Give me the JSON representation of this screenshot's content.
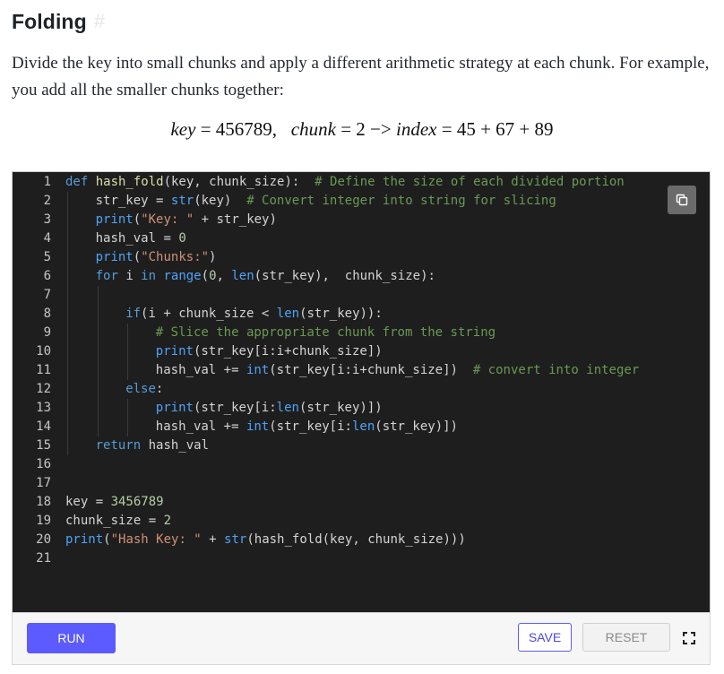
{
  "section": {
    "title": "Folding",
    "anchor": "#"
  },
  "intro": "Divide the key into small chunks and apply a different arithmetic strategy at each chunk. For example, you add all the smaller chunks together:",
  "formula": {
    "key_name": "key",
    "eq1": " = ",
    "key_value": "456789",
    "sep": ",   ",
    "chunk_name": "chunk",
    "eq2": " = ",
    "chunk_value": "2",
    "arrow": " −> ",
    "index_name": "index",
    "eq3": " = ",
    "index_expr": "45 + 67 + 89"
  },
  "editor": {
    "copy_icon": "copy-icon",
    "lines": [
      {
        "n": "1",
        "indent": 0,
        "tokens": [
          [
            "kw",
            "def "
          ],
          [
            "fn",
            "hash_fold"
          ],
          [
            "pl",
            "(key, chunk_size):  "
          ],
          [
            "com",
            "# Define the size of each divided portion"
          ]
        ]
      },
      {
        "n": "2",
        "indent": 1,
        "tokens": [
          [
            "pl",
            "str_key = "
          ],
          [
            "bi",
            "str"
          ],
          [
            "pl",
            "(key)  "
          ],
          [
            "com",
            "# Convert integer into string for slicing"
          ]
        ]
      },
      {
        "n": "3",
        "indent": 1,
        "tokens": [
          [
            "bi",
            "print"
          ],
          [
            "pl",
            "("
          ],
          [
            "str",
            "\"Key: \""
          ],
          [
            "pl",
            " + str_key)"
          ]
        ]
      },
      {
        "n": "4",
        "indent": 1,
        "tokens": [
          [
            "pl",
            "hash_val = "
          ],
          [
            "num",
            "0"
          ]
        ]
      },
      {
        "n": "5",
        "indent": 1,
        "tokens": [
          [
            "bi",
            "print"
          ],
          [
            "pl",
            "("
          ],
          [
            "str",
            "\"Chunks:\""
          ],
          [
            "pl",
            ")"
          ]
        ]
      },
      {
        "n": "6",
        "indent": 1,
        "tokens": [
          [
            "kw",
            "for "
          ],
          [
            "pl",
            "i "
          ],
          [
            "kw",
            "in "
          ],
          [
            "bi",
            "range"
          ],
          [
            "pl",
            "("
          ],
          [
            "num",
            "0"
          ],
          [
            "pl",
            ", "
          ],
          [
            "bi",
            "len"
          ],
          [
            "pl",
            "(str_key),  chunk_size):"
          ]
        ]
      },
      {
        "n": "7",
        "indent": 0,
        "tokens": []
      },
      {
        "n": "8",
        "indent": 2,
        "tokens": [
          [
            "kw",
            "if"
          ],
          [
            "pl",
            "(i + chunk_size < "
          ],
          [
            "bi",
            "len"
          ],
          [
            "pl",
            "(str_key)):"
          ]
        ]
      },
      {
        "n": "9",
        "indent": 3,
        "tokens": [
          [
            "com",
            "# Slice the appropriate chunk from the string"
          ]
        ]
      },
      {
        "n": "10",
        "indent": 3,
        "tokens": [
          [
            "bi",
            "print"
          ],
          [
            "pl",
            "(str_key[i:i+chunk_size])"
          ]
        ]
      },
      {
        "n": "11",
        "indent": 3,
        "tokens": [
          [
            "pl",
            "hash_val += "
          ],
          [
            "bi",
            "int"
          ],
          [
            "pl",
            "(str_key[i:i+chunk_size])  "
          ],
          [
            "com",
            "# convert into integer"
          ]
        ]
      },
      {
        "n": "12",
        "indent": 2,
        "tokens": [
          [
            "kw",
            "else"
          ],
          [
            "pl",
            ":"
          ]
        ]
      },
      {
        "n": "13",
        "indent": 3,
        "tokens": [
          [
            "bi",
            "print"
          ],
          [
            "pl",
            "(str_key[i:"
          ],
          [
            "bi",
            "len"
          ],
          [
            "pl",
            "(str_key)])"
          ]
        ]
      },
      {
        "n": "14",
        "indent": 3,
        "tokens": [
          [
            "pl",
            "hash_val += "
          ],
          [
            "bi",
            "int"
          ],
          [
            "pl",
            "(str_key[i:"
          ],
          [
            "bi",
            "len"
          ],
          [
            "pl",
            "(str_key)])"
          ]
        ]
      },
      {
        "n": "15",
        "indent": 1,
        "tokens": [
          [
            "kw",
            "return "
          ],
          [
            "pl",
            "hash_val"
          ]
        ]
      },
      {
        "n": "16",
        "indent": 0,
        "tokens": []
      },
      {
        "n": "17",
        "indent": 0,
        "tokens": []
      },
      {
        "n": "18",
        "indent": 0,
        "tokens": [
          [
            "pl",
            "key = "
          ],
          [
            "num",
            "3456789"
          ]
        ]
      },
      {
        "n": "19",
        "indent": 0,
        "tokens": [
          [
            "pl",
            "chunk_size = "
          ],
          [
            "num",
            "2"
          ]
        ]
      },
      {
        "n": "20",
        "indent": 0,
        "tokens": [
          [
            "bi",
            "print"
          ],
          [
            "pl",
            "("
          ],
          [
            "str",
            "\"Hash Key: \""
          ],
          [
            "pl",
            " + "
          ],
          [
            "bi",
            "str"
          ],
          [
            "pl",
            "(hash_fold(key, chunk_size)))"
          ]
        ]
      },
      {
        "n": "21",
        "indent": 0,
        "tokens": []
      }
    ]
  },
  "toolbar": {
    "run_label": "RUN",
    "save_label": "SAVE",
    "reset_label": "RESET",
    "fullscreen_icon": "fullscreen-icon"
  },
  "colors": {
    "editor_bg": "#1e1e1e",
    "run_button": "#5b5bff",
    "keyword": "#569cd6",
    "builtin": "#4fa3f7",
    "string": "#ce9178",
    "number": "#b5cea8",
    "comment": "#6a9955"
  }
}
